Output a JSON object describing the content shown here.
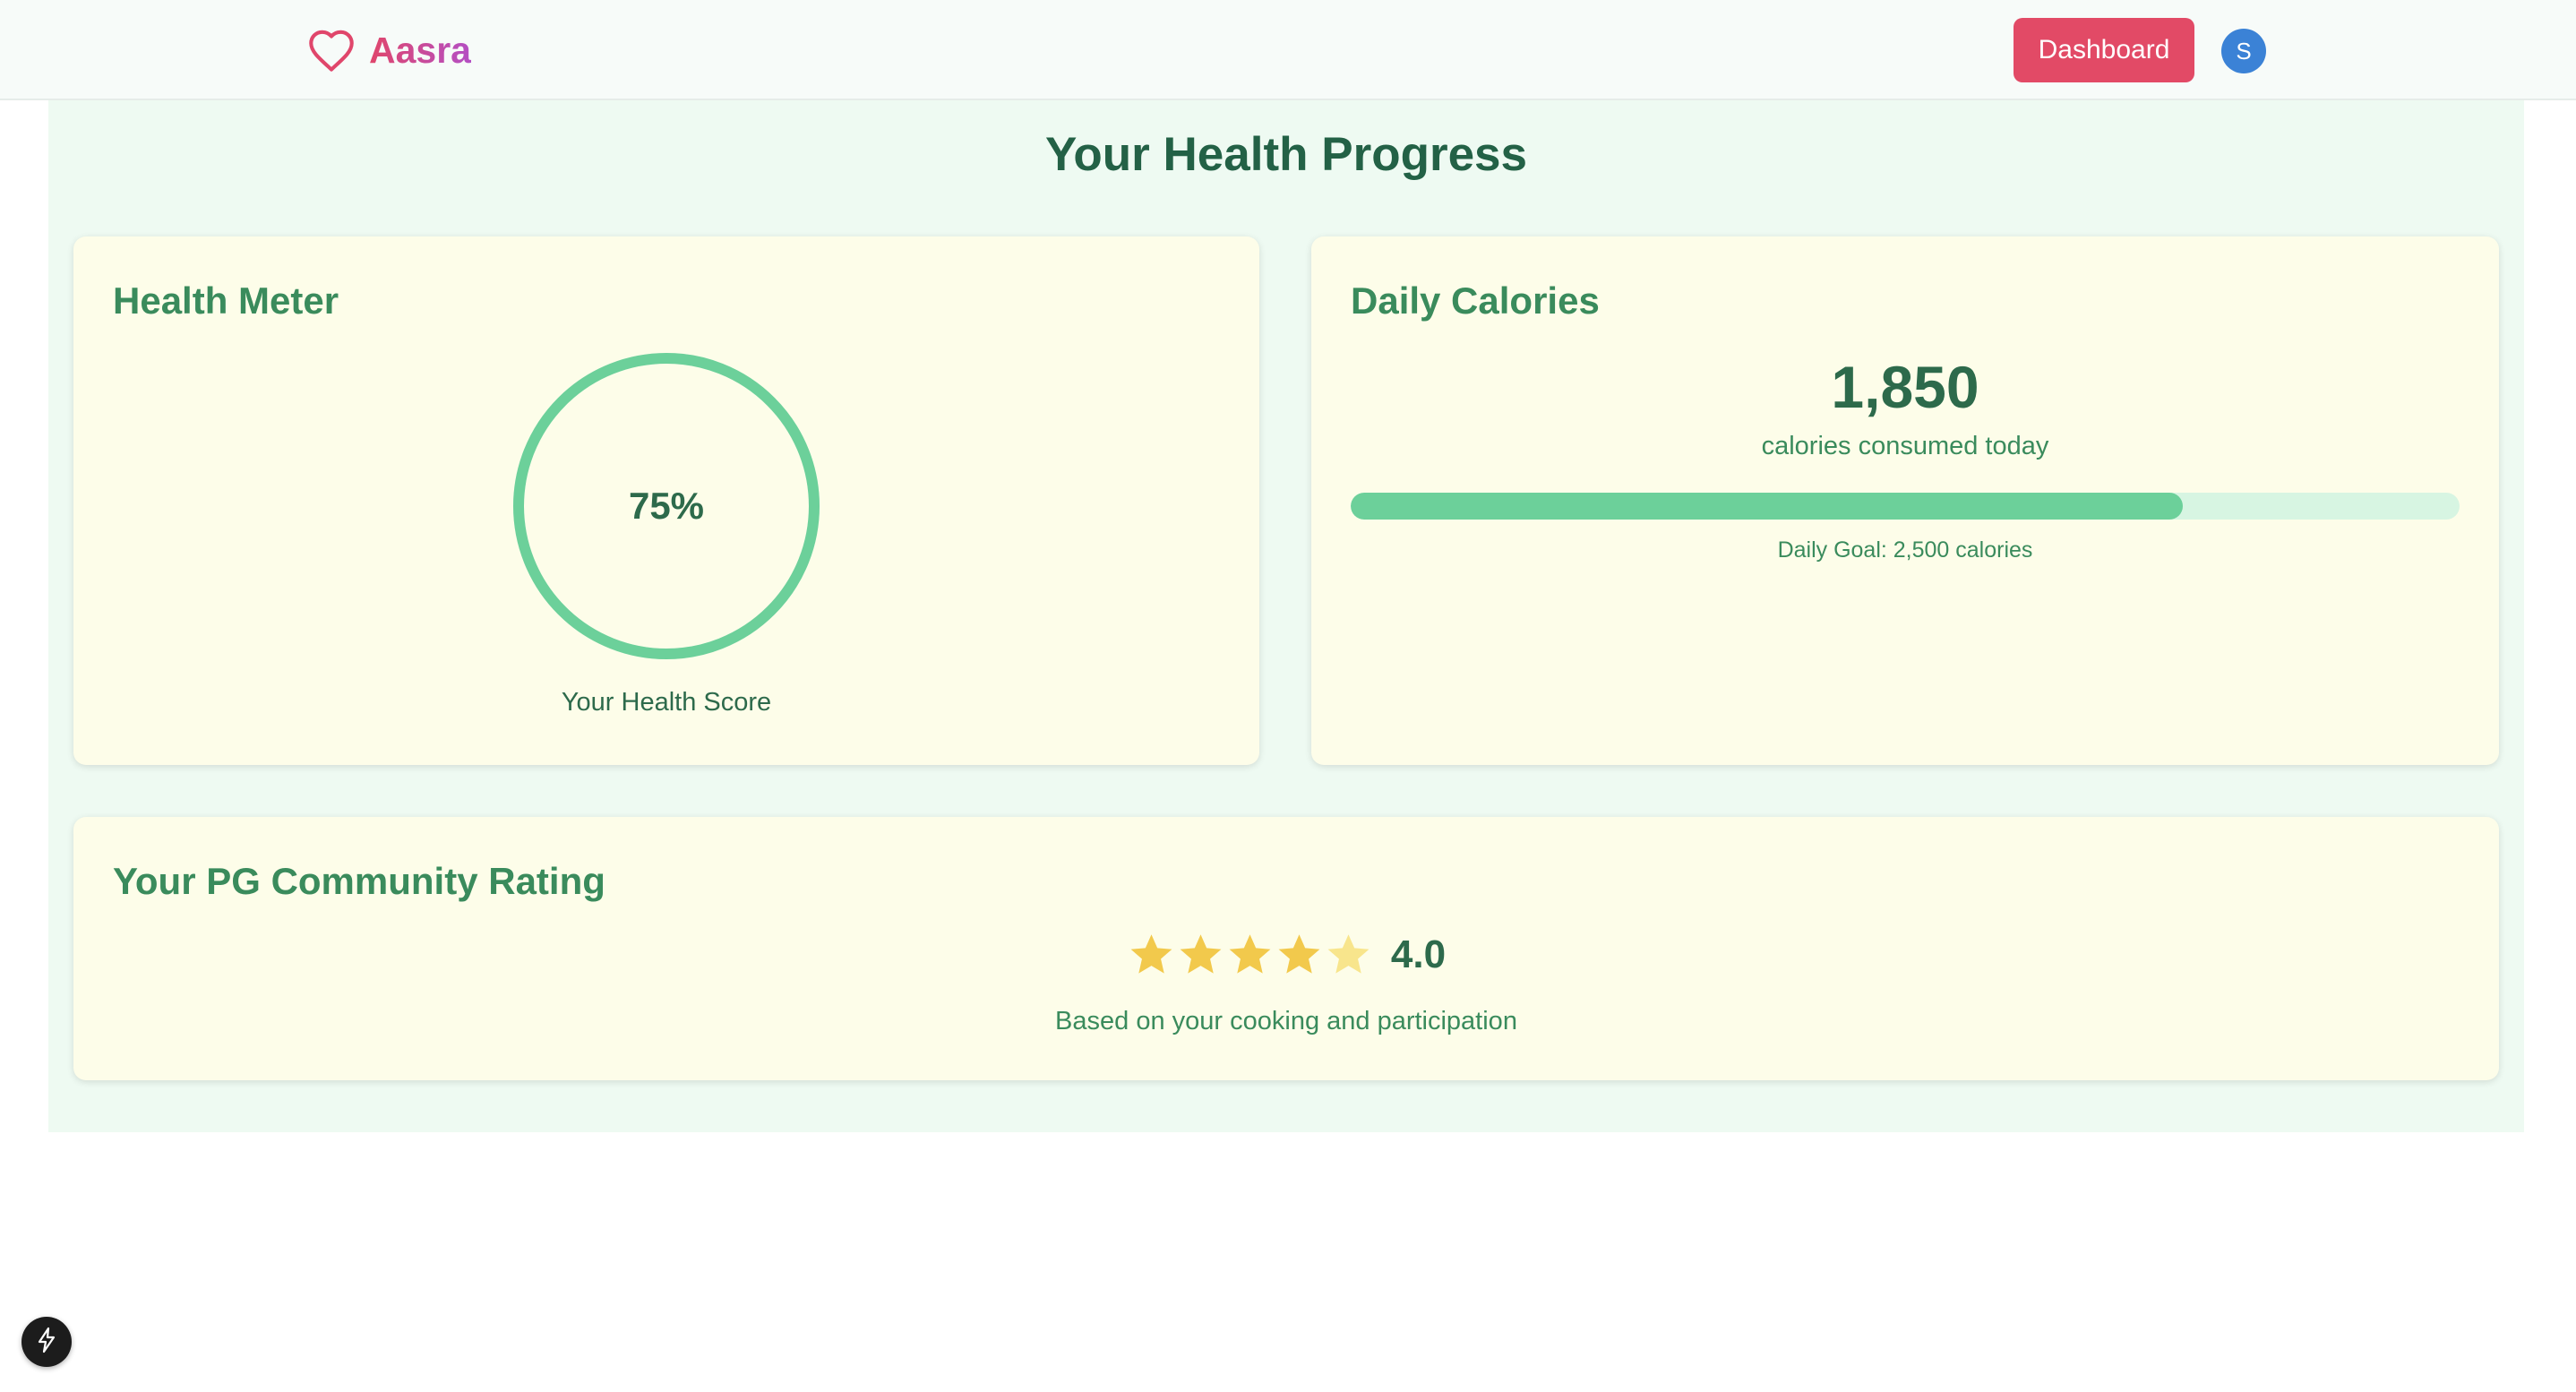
{
  "app": {
    "brand_name": "Aasra",
    "brand_icon": "heart-icon"
  },
  "nav": {
    "dashboard_label": "Dashboard",
    "avatar_initial": "S"
  },
  "page": {
    "title": "Your Health Progress"
  },
  "health_meter": {
    "title": "Health Meter",
    "value_label": "75%",
    "value_fraction": 0.75,
    "caption": "Your Health Score"
  },
  "calories": {
    "title": "Daily Calories",
    "value": "1,850",
    "subtitle": "calories consumed today",
    "progress_fraction": 0.75,
    "goal_label": "Daily Goal: 2,500 calories"
  },
  "rating": {
    "title": "Your PG Community Rating",
    "stars_filled": 4,
    "stars_total": 5,
    "value": "4.0",
    "note": "Based on your cooking and participation"
  },
  "colors": {
    "accent_green": "#6cd09a",
    "brand_pink": "#e0466b",
    "brand_purple": "#b44fc4",
    "star_filled": "#f2c94c",
    "star_empty": "#f8e58c"
  },
  "dev_indicator": {
    "icon": "lightning-icon"
  }
}
